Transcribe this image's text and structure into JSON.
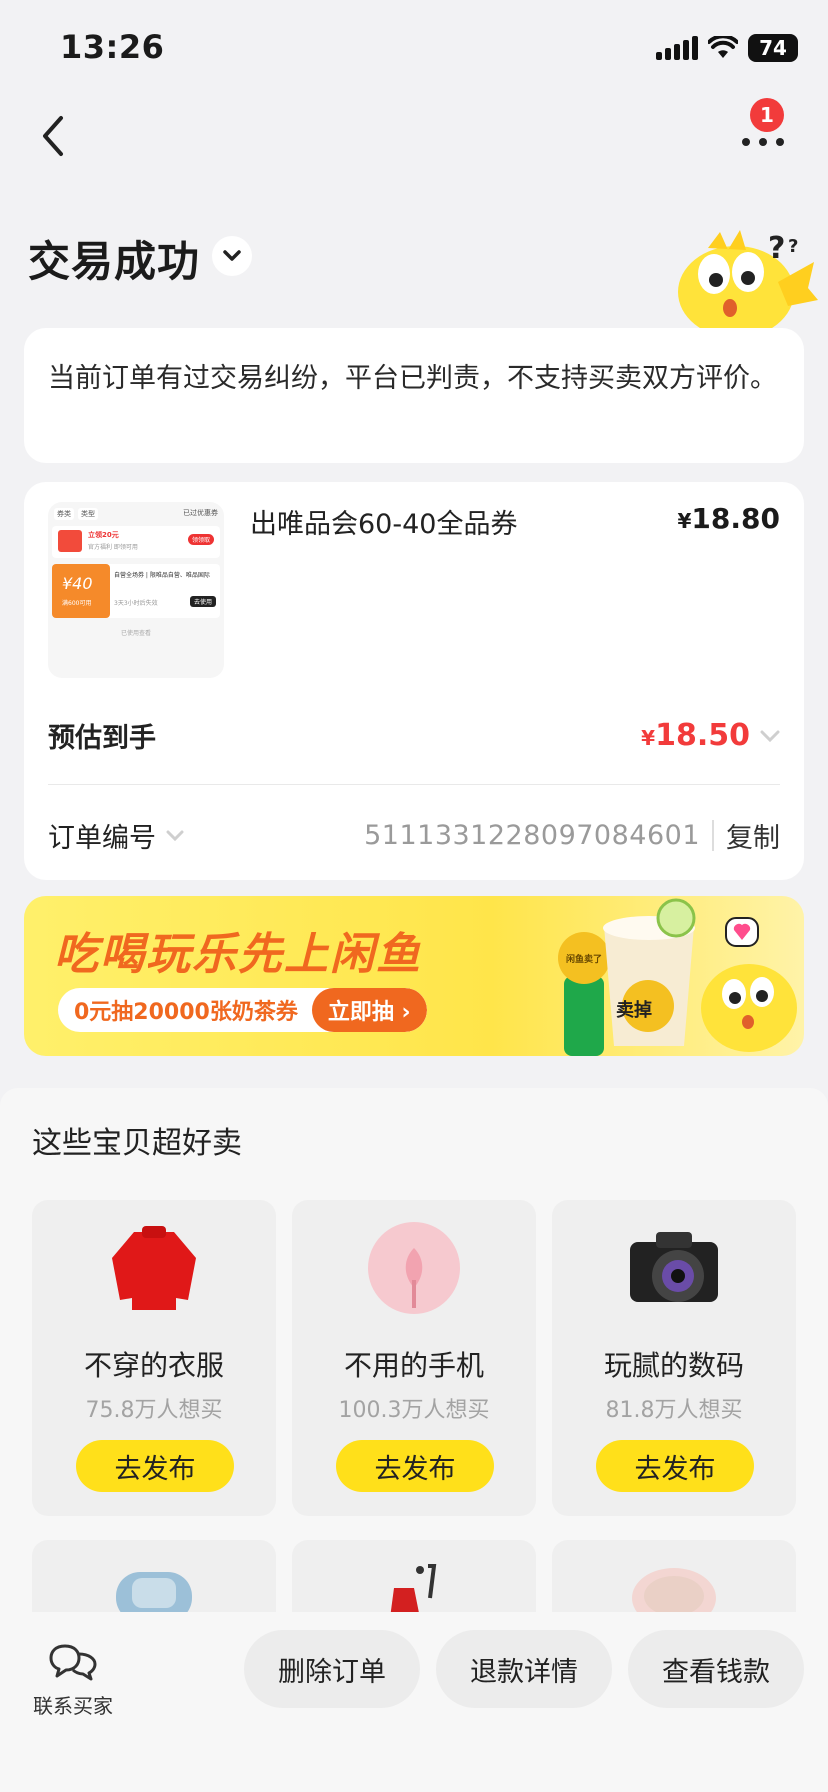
{
  "status_bar": {
    "time": "13:26",
    "battery": "74"
  },
  "header": {
    "notification_count": "1"
  },
  "order_status": {
    "title": "交易成功"
  },
  "notice": {
    "text": "当前订单有过交易纠纷，平台已判责，不支持买卖双方评价。"
  },
  "order": {
    "product_name": "出唯品会60-40全品券",
    "currency_symbol": "¥",
    "price": "18.80",
    "estimated_label": "预估到手",
    "estimated_price": "18.50",
    "order_no_label": "订单编号",
    "order_no": "5111331228097084601",
    "copy_label": "复制",
    "thumb": {
      "tag1": "券类",
      "tag2": "类型",
      "tag3": "已过优惠券",
      "coupon1_title": "立领20元",
      "coupon1_sub": "官方福利 即领可用",
      "coupon1_btn": "领领取",
      "coupon2_amount": "¥40",
      "coupon2_min": "满600可用",
      "coupon2_title": "自营全场券 | 限唯品自营、唯品国际",
      "coupon2_sub": "3天3小时后失效",
      "coupon2_btn": "去使用",
      "footer": "已使用查看"
    }
  },
  "banner": {
    "title": "吃喝玩乐先上闲鱼",
    "subtitle": "0元抽20000张奶茶券",
    "cta": "立即抽 ›",
    "art_tag": "卖掉",
    "art_label": "闲鱼卖了"
  },
  "sell_section": {
    "title": "这些宝贝超好卖",
    "items": [
      {
        "name": "不穿的衣服",
        "count": "75.8万人想买",
        "button": "去发布"
      },
      {
        "name": "不用的手机",
        "count": "100.3万人想买",
        "button": "去发布"
      },
      {
        "name": "玩腻的数码",
        "count": "81.8万人想买",
        "button": "去发布"
      }
    ]
  },
  "bottom_bar": {
    "contact_label": "联系买家",
    "actions": [
      "删除订单",
      "退款详情",
      "查看钱款"
    ]
  },
  "colors": {
    "accent_red": "#f23b3b",
    "brand_yellow": "#ffe01a",
    "banner_orange": "#f0681f"
  }
}
